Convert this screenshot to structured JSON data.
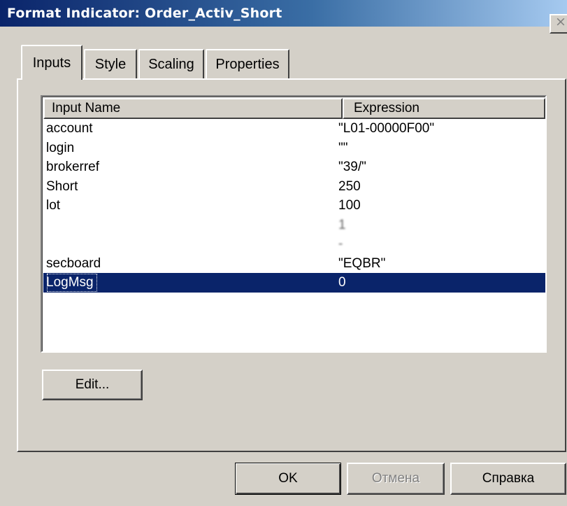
{
  "window": {
    "title": "Format Indicator: Order_Activ_Short",
    "close_glyph": "×"
  },
  "tabs": [
    {
      "label": "Inputs",
      "active": true
    },
    {
      "label": "Style",
      "active": false
    },
    {
      "label": "Scaling",
      "active": false
    },
    {
      "label": "Properties",
      "active": false
    }
  ],
  "inputs_list": {
    "columns": [
      "Input Name",
      "Expression"
    ],
    "rows": [
      {
        "name": "account",
        "expression": "\"L01-00000F00\"",
        "selected": false
      },
      {
        "name": "login",
        "expression": "\"\"",
        "selected": false
      },
      {
        "name": "brokerref",
        "expression": "\"39/\"",
        "selected": false
      },
      {
        "name": "Short",
        "expression": "250",
        "selected": false
      },
      {
        "name": "lot",
        "expression": "100",
        "selected": false
      },
      {
        "name": "",
        "expression": "1",
        "selected": false
      },
      {
        "name": "",
        "expression": "-",
        "selected": false
      },
      {
        "name": "secboard",
        "expression": "\"EQBR\"",
        "selected": false
      },
      {
        "name": "LogMsg",
        "expression": "0",
        "selected": true
      }
    ]
  },
  "buttons": {
    "edit": "Edit...",
    "ok": "OK",
    "cancel": "Отмена",
    "help": "Справка"
  }
}
